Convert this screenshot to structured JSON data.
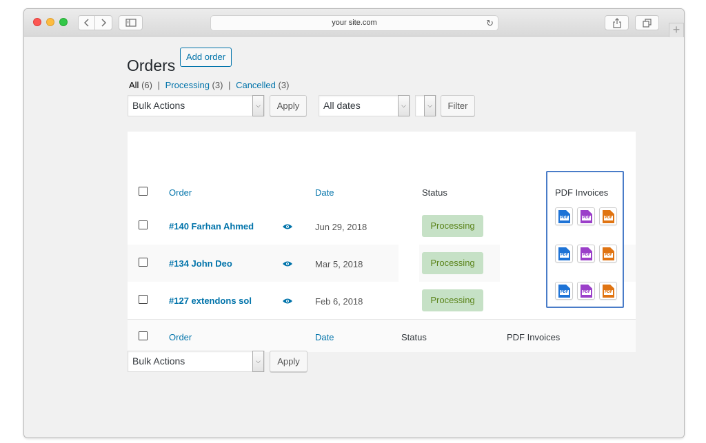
{
  "browser": {
    "url": "your site.com"
  },
  "page": {
    "title": "Orders",
    "add_order_label": "Add order"
  },
  "filters_nav": {
    "all_label": "All",
    "all_count": "(6)",
    "processing_label": "Processing",
    "processing_count": "(3)",
    "cancelled_label": "Cancelled",
    "cancelled_count": "(3)",
    "separator": "|"
  },
  "tablenav_top": {
    "bulk_actions": "Bulk Actions",
    "apply_label": "Apply",
    "dates_select": "All dates",
    "filter_label": "Filter"
  },
  "table": {
    "columns": {
      "order": "Order",
      "date": "Date",
      "status": "Status",
      "pdf_invoices": "PDF Invoices"
    },
    "rows": [
      {
        "order": "#140 Farhan Ahmed",
        "date": "Jun 29, 2018",
        "status": "Processing"
      },
      {
        "order": "#134 John Deo",
        "date": "Mar 5, 2018",
        "status": "Processing"
      },
      {
        "order": "#127 extendons sol",
        "date": "Feb 6, 2018",
        "status": "Processing"
      }
    ],
    "pdf_icon_label": "PDF",
    "pdf_icon_colors": [
      "#1e73d6",
      "#9b3fc9",
      "#e07412"
    ]
  },
  "tablenav_bottom": {
    "bulk_actions": "Bulk Actions",
    "apply_label": "Apply"
  },
  "colors": {
    "link": "#0073aa",
    "status_bg": "#c6e1c6",
    "status_text": "#5b841b",
    "highlight": "#4a7cc8"
  }
}
